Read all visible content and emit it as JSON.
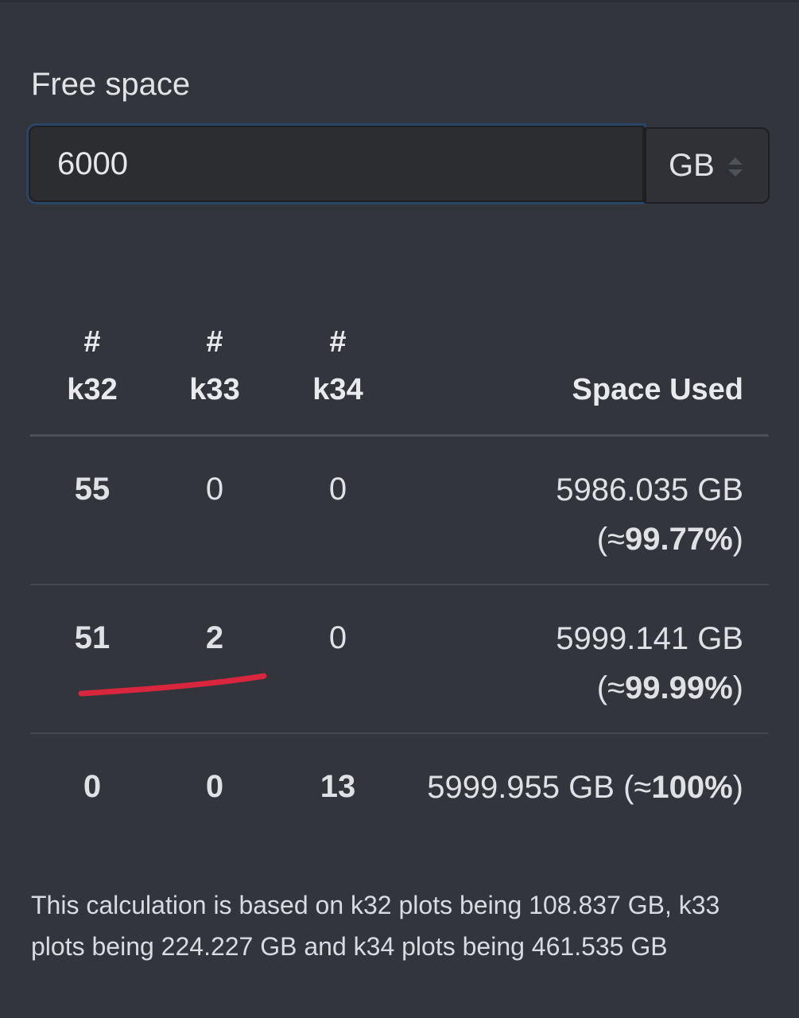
{
  "form": {
    "label": "Free space",
    "value": "6000",
    "unit": "GB"
  },
  "table": {
    "headers": {
      "hash": "#",
      "k32": "k32",
      "k33": "k33",
      "k34": "k34",
      "space_used": "Space Used"
    },
    "rows": [
      {
        "k32": "55",
        "k33": "0",
        "k34": "0",
        "space": "5986.035 GB",
        "pct_open": "(≈",
        "pct": "99.77%",
        "pct_close": ")"
      },
      {
        "k32": "51",
        "k33": "2",
        "k34": "0",
        "space": "5999.141 GB",
        "pct_open": "(≈",
        "pct": "99.99%",
        "pct_close": ")"
      },
      {
        "k32": "0",
        "k33": "0",
        "k34": "13",
        "space": "5999.955 GB",
        "pct_open": "(≈",
        "pct": "100%",
        "pct_close": ")"
      }
    ]
  },
  "annotation": {
    "color": "#d8263f"
  },
  "footnote": "This calculation is based on k32 plots being 108.837 GB, k33 plots being 224.227 GB and k34 plots being 461.535 GB"
}
